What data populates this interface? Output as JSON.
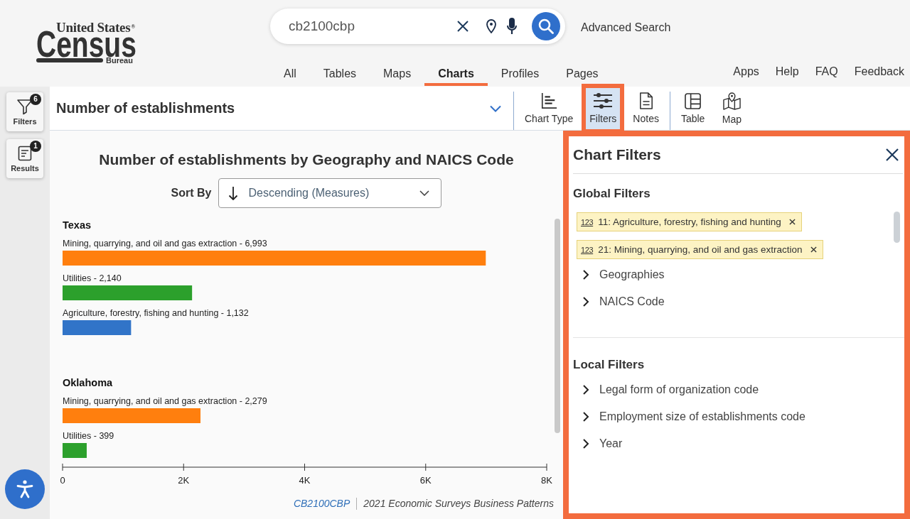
{
  "header": {
    "logo": {
      "top": "United States$^{®}$",
      "main": "Census",
      "bottom": "Bureau"
    },
    "search": {
      "value": "cb2100cbp"
    },
    "advanced_search": "Advanced Search",
    "nav_tabs": [
      {
        "label": "All",
        "selected": false
      },
      {
        "label": "Tables",
        "selected": false
      },
      {
        "label": "Maps",
        "selected": false
      },
      {
        "label": "Charts",
        "selected": true
      },
      {
        "label": "Profiles",
        "selected": false
      },
      {
        "label": "Pages",
        "selected": false
      }
    ],
    "utility_links": [
      "Apps",
      "Help",
      "FAQ",
      "Feedback"
    ]
  },
  "left_rail": [
    {
      "kind": "filters",
      "label": "Filters",
      "badge": "6"
    },
    {
      "kind": "results",
      "label": "Results",
      "badge": "1"
    }
  ],
  "toolbar": {
    "measure": "Number of establishments",
    "button_groups": [
      [
        {
          "kind": "chart-type",
          "label": "Chart Type",
          "selected": false,
          "highlighted": false
        },
        {
          "kind": "filters",
          "label": "Filters",
          "selected": true,
          "highlighted": true
        },
        {
          "kind": "notes",
          "label": "Notes",
          "selected": false,
          "highlighted": false
        }
      ],
      [
        {
          "kind": "table",
          "label": "Table",
          "selected": false,
          "highlighted": false
        },
        {
          "kind": "map",
          "label": "Map",
          "selected": false,
          "highlighted": false
        }
      ]
    ]
  },
  "chart": {
    "title": "Number of establishments by Geography and NAICS Code",
    "sort_label": "Sort By",
    "sort_value": "Descending (Measures)",
    "chart_data": {
      "type": "bar",
      "orientation": "horizontal",
      "categories": [
        "Texas",
        "Oklahoma"
      ],
      "series": [
        {
          "color": "#ff7f0e",
          "values": [
            6993,
            2279
          ]
        },
        {
          "color": "#2ca02c",
          "values": [
            2140,
            399
          ]
        },
        {
          "color": "#3174c8",
          "values": [
            1132,
            null
          ]
        }
      ],
      "xlim": [
        0,
        8000
      ],
      "xticks": [
        {
          "value": 0,
          "label": "0"
        },
        {
          "value": 2000,
          "label": "2K"
        },
        {
          "value": 4000,
          "label": "4K"
        },
        {
          "value": 6000,
          "label": "6K"
        },
        {
          "value": 8000,
          "label": "8K"
        }
      ],
      "value_labels": [
        [
          "Mining, quarrying, and oil and gas extraction - 6,993",
          "Utilities - 2,140",
          "Agriculture, forestry, fishing and hunting - 1,132"
        ],
        [
          "Mining, quarrying, and oil and gas extraction - 2,279",
          "Utilities - 399",
          null
        ]
      ]
    },
    "source_code": "CB2100CBP",
    "source_name": "2021 Economic Surveys Business Patterns"
  },
  "filters_panel": {
    "title": "Chart Filters",
    "highlighted": true,
    "global_title": "Global Filters",
    "chips": [
      {
        "type_icon": "123",
        "label": "11: Agriculture, forestry, fishing and hunting"
      },
      {
        "type_icon": "123",
        "label": "21: Mining, quarrying, and oil and gas extraction"
      }
    ],
    "global_items": [
      {
        "label": "Geographies",
        "expanded": false
      },
      {
        "label": "NAICS Code",
        "expanded": false
      }
    ],
    "local_title": "Local Filters",
    "local_items": [
      {
        "label": "Legal form of organization code",
        "expanded": false
      },
      {
        "label": "Employment size of establishments code",
        "expanded": false
      },
      {
        "label": "Year",
        "expanded": false
      }
    ]
  }
}
